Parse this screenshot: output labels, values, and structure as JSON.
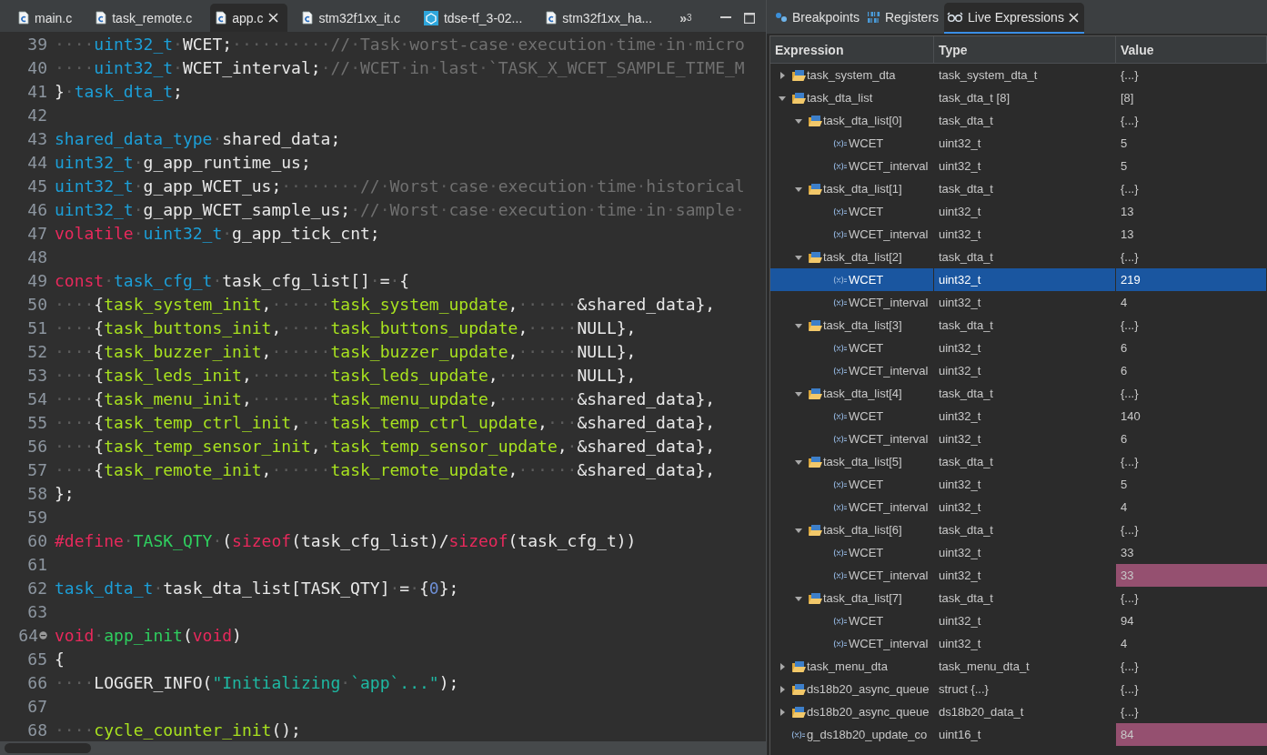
{
  "editor_tabs": [
    {
      "label": "main.c",
      "kind": "c-file",
      "selected": false
    },
    {
      "label": "task_remote.c",
      "kind": "c-file",
      "selected": false
    },
    {
      "label": "app.c",
      "kind": "c-file",
      "selected": true
    },
    {
      "label": "stm32f1xx_it.c",
      "kind": "c-file",
      "selected": false
    },
    {
      "label": "tdse-tf_3-02...",
      "kind": "mx-file",
      "selected": false
    },
    {
      "label": "stm32f1xx_ha...",
      "kind": "c-file",
      "selected": false
    }
  ],
  "overflow_tabs": {
    "symbol": "»",
    "count": "3"
  },
  "code_lines": [
    {
      "number": "39",
      "tokens": [
        {
          "kind": "plain",
          "text": "····"
        },
        {
          "kind": "type",
          "text": "uint32_t"
        },
        {
          "kind": "plain",
          "text": "·WCET;··········"
        },
        {
          "kind": "comment",
          "text": "//·Task·worst-case·execution·time·in·micro"
        }
      ]
    },
    {
      "number": "40",
      "tokens": [
        {
          "kind": "plain",
          "text": "····"
        },
        {
          "kind": "type",
          "text": "uint32_t"
        },
        {
          "kind": "plain",
          "text": "·WCET_interval;·"
        },
        {
          "kind": "comment",
          "text": "//·WCET·in·last·`TASK_X_WCET_SAMPLE_TIME_M"
        }
      ]
    },
    {
      "number": "41",
      "tokens": [
        {
          "kind": "plain",
          "text": "}·"
        },
        {
          "kind": "type",
          "text": "task_dta_t"
        },
        {
          "kind": "plain",
          "text": ";"
        }
      ]
    },
    {
      "number": "42"
    },
    {
      "number": "43",
      "tokens": [
        {
          "kind": "type",
          "text": "shared_data_type"
        },
        {
          "kind": "plain",
          "text": "·shared_data;"
        }
      ]
    },
    {
      "number": "44",
      "tokens": [
        {
          "kind": "type",
          "text": "uint32_t"
        },
        {
          "kind": "plain",
          "text": "·g_app_runtime_us;"
        }
      ]
    },
    {
      "number": "45",
      "tokens": [
        {
          "kind": "type",
          "text": "uint32_t"
        },
        {
          "kind": "plain",
          "text": "·g_app_WCET_us;········"
        },
        {
          "kind": "comment",
          "text": "//·Worst·case·execution·time·historical"
        }
      ]
    },
    {
      "number": "46",
      "tokens": [
        {
          "kind": "type",
          "text": "uint32_t"
        },
        {
          "kind": "plain",
          "text": "·g_app_WCET_sample_us;·"
        },
        {
          "kind": "comment",
          "text": "//·Worst·case·execution·time·in·sample·"
        }
      ]
    },
    {
      "number": "47",
      "tokens": [
        {
          "kind": "keyword",
          "text": "volatile"
        },
        {
          "kind": "plain",
          "text": "·"
        },
        {
          "kind": "type",
          "text": "uint32_t"
        },
        {
          "kind": "plain",
          "text": "·g_app_tick_cnt;"
        }
      ]
    },
    {
      "number": "48"
    },
    {
      "number": "49",
      "tokens": [
        {
          "kind": "keyword",
          "text": "const"
        },
        {
          "kind": "plain",
          "text": "·"
        },
        {
          "kind": "type",
          "text": "task_cfg_t"
        },
        {
          "kind": "plain",
          "text": "·task_cfg_list[]·=·{"
        }
      ]
    },
    {
      "number": "50",
      "tokens": [
        {
          "kind": "plain",
          "text": "····{"
        },
        {
          "kind": "function",
          "text": "task_system_init"
        },
        {
          "kind": "plain",
          "text": ",······"
        },
        {
          "kind": "function",
          "text": "task_system_update"
        },
        {
          "kind": "plain",
          "text": ",······&shared_data},"
        }
      ]
    },
    {
      "number": "51",
      "tokens": [
        {
          "kind": "plain",
          "text": "····{"
        },
        {
          "kind": "function",
          "text": "task_buttons_init"
        },
        {
          "kind": "plain",
          "text": ",·····"
        },
        {
          "kind": "function",
          "text": "task_buttons_update"
        },
        {
          "kind": "plain",
          "text": ",·····NULL},"
        }
      ]
    },
    {
      "number": "52",
      "tokens": [
        {
          "kind": "plain",
          "text": "····{"
        },
        {
          "kind": "function",
          "text": "task_buzzer_init"
        },
        {
          "kind": "plain",
          "text": ",······"
        },
        {
          "kind": "function",
          "text": "task_buzzer_update"
        },
        {
          "kind": "plain",
          "text": ",······NULL},"
        }
      ]
    },
    {
      "number": "53",
      "tokens": [
        {
          "kind": "plain",
          "text": "····{"
        },
        {
          "kind": "function",
          "text": "task_leds_init"
        },
        {
          "kind": "plain",
          "text": ",········"
        },
        {
          "kind": "function",
          "text": "task_leds_update"
        },
        {
          "kind": "plain",
          "text": ",········NULL},"
        }
      ]
    },
    {
      "number": "54",
      "tokens": [
        {
          "kind": "plain",
          "text": "····{"
        },
        {
          "kind": "function",
          "text": "task_menu_init"
        },
        {
          "kind": "plain",
          "text": ",········"
        },
        {
          "kind": "function",
          "text": "task_menu_update"
        },
        {
          "kind": "plain",
          "text": ",········&shared_data},"
        }
      ]
    },
    {
      "number": "55",
      "tokens": [
        {
          "kind": "plain",
          "text": "····{"
        },
        {
          "kind": "function",
          "text": "task_temp_ctrl_init"
        },
        {
          "kind": "plain",
          "text": ",···"
        },
        {
          "kind": "function",
          "text": "task_temp_ctrl_update"
        },
        {
          "kind": "plain",
          "text": ",···&shared_data},"
        }
      ]
    },
    {
      "number": "56",
      "tokens": [
        {
          "kind": "plain",
          "text": "····{"
        },
        {
          "kind": "function",
          "text": "task_temp_sensor_init"
        },
        {
          "kind": "plain",
          "text": ",·"
        },
        {
          "kind": "function",
          "text": "task_temp_sensor_update"
        },
        {
          "kind": "plain",
          "text": ",·&shared_data},"
        }
      ]
    },
    {
      "number": "57",
      "tokens": [
        {
          "kind": "plain",
          "text": "····{"
        },
        {
          "kind": "function",
          "text": "task_remote_init"
        },
        {
          "kind": "plain",
          "text": ",······"
        },
        {
          "kind": "function",
          "text": "task_remote_update"
        },
        {
          "kind": "plain",
          "text": ",······&shared_data},"
        }
      ]
    },
    {
      "number": "58",
      "tokens": [
        {
          "kind": "plain",
          "text": "};"
        }
      ]
    },
    {
      "number": "59"
    },
    {
      "number": "60",
      "tokens": [
        {
          "kind": "keyword",
          "text": "#define"
        },
        {
          "kind": "plain",
          "text": "·"
        },
        {
          "kind": "definition",
          "text": "TASK_QTY"
        },
        {
          "kind": "plain",
          "text": "·("
        },
        {
          "kind": "keyword",
          "text": "sizeof"
        },
        {
          "kind": "plain",
          "text": "(task_cfg_list)/"
        },
        {
          "kind": "keyword",
          "text": "sizeof"
        },
        {
          "kind": "plain",
          "text": "(task_cfg_t))"
        }
      ]
    },
    {
      "number": "61"
    },
    {
      "number": "62",
      "tokens": [
        {
          "kind": "type",
          "text": "task_dta_t"
        },
        {
          "kind": "plain",
          "text": "·task_dta_list[TASK_QTY]·=·{"
        },
        {
          "kind": "number",
          "text": "0"
        },
        {
          "kind": "plain",
          "text": "};"
        }
      ]
    },
    {
      "number": "63"
    },
    {
      "number": "64",
      "fold": true,
      "tokens": [
        {
          "kind": "keyword",
          "text": "void"
        },
        {
          "kind": "plain",
          "text": "·"
        },
        {
          "kind": "definition",
          "text": "app_init"
        },
        {
          "kind": "plain",
          "text": "("
        },
        {
          "kind": "keyword",
          "text": "void"
        },
        {
          "kind": "plain",
          "text": ")"
        }
      ]
    },
    {
      "number": "65",
      "tokens": [
        {
          "kind": "plain",
          "text": "{"
        }
      ]
    },
    {
      "number": "66",
      "tokens": [
        {
          "kind": "plain",
          "text": "····LOGGER_INFO("
        },
        {
          "kind": "string",
          "text": "\"Initializing·`app`...\""
        },
        {
          "kind": "plain",
          "text": ");"
        }
      ]
    },
    {
      "number": "67"
    },
    {
      "number": "68",
      "tokens": [
        {
          "kind": "plain",
          "text": "····"
        },
        {
          "kind": "function",
          "text": "cycle_counter_init"
        },
        {
          "kind": "plain",
          "text": "();"
        }
      ]
    }
  ],
  "view_tabs": [
    {
      "label": "Breakpoints",
      "kind": "breakpoints",
      "selected": false
    },
    {
      "label": "Registers",
      "kind": "registers",
      "selected": false
    },
    {
      "label": "Live Expressions",
      "kind": "expressions",
      "selected": true
    }
  ],
  "table": {
    "columns": [
      "Expression",
      "Type",
      "Value"
    ],
    "rows": [
      {
        "name": "task_system_dta",
        "type": "task_system_dta_t",
        "value": "{...}",
        "kind": "struct",
        "expanded": false,
        "selected": false,
        "changed": false
      },
      {
        "name": "task_dta_list",
        "type": "task_dta_t [8]",
        "value": "[8]",
        "kind": "struct",
        "expanded": true,
        "selected": false,
        "changed": false,
        "children": [
          {
            "name": "task_dta_list[0]",
            "type": "task_dta_t",
            "value": "{...}",
            "kind": "struct",
            "expanded": true,
            "selected": false,
            "changed": false,
            "children": [
              {
                "name": "WCET",
                "type": "uint32_t",
                "value": "5",
                "kind": "variable",
                "selected": false,
                "changed": false
              },
              {
                "name": "WCET_interval",
                "type": "uint32_t",
                "value": "5",
                "kind": "variable",
                "selected": false,
                "changed": false
              }
            ]
          },
          {
            "name": "task_dta_list[1]",
            "type": "task_dta_t",
            "value": "{...}",
            "kind": "struct",
            "expanded": true,
            "selected": false,
            "changed": false,
            "children": [
              {
                "name": "WCET",
                "type": "uint32_t",
                "value": "13",
                "kind": "variable",
                "selected": false,
                "changed": false
              },
              {
                "name": "WCET_interval",
                "type": "uint32_t",
                "value": "13",
                "kind": "variable",
                "selected": false,
                "changed": false
              }
            ]
          },
          {
            "name": "task_dta_list[2]",
            "type": "task_dta_t",
            "value": "{...}",
            "kind": "struct",
            "expanded": true,
            "selected": false,
            "changed": false,
            "children": [
              {
                "name": "WCET",
                "type": "uint32_t",
                "value": "219",
                "kind": "variable",
                "selected": true,
                "changed": false
              },
              {
                "name": "WCET_interval",
                "type": "uint32_t",
                "value": "4",
                "kind": "variable",
                "selected": false,
                "changed": false
              }
            ]
          },
          {
            "name": "task_dta_list[3]",
            "type": "task_dta_t",
            "value": "{...}",
            "kind": "struct",
            "expanded": true,
            "selected": false,
            "changed": false,
            "children": [
              {
                "name": "WCET",
                "type": "uint32_t",
                "value": "6",
                "kind": "variable",
                "selected": false,
                "changed": false
              },
              {
                "name": "WCET_interval",
                "type": "uint32_t",
                "value": "6",
                "kind": "variable",
                "selected": false,
                "changed": false
              }
            ]
          },
          {
            "name": "task_dta_list[4]",
            "type": "task_dta_t",
            "value": "{...}",
            "kind": "struct",
            "expanded": true,
            "selected": false,
            "changed": false,
            "children": [
              {
                "name": "WCET",
                "type": "uint32_t",
                "value": "140",
                "kind": "variable",
                "selected": false,
                "changed": false
              },
              {
                "name": "WCET_interval",
                "type": "uint32_t",
                "value": "6",
                "kind": "variable",
                "selected": false,
                "changed": false
              }
            ]
          },
          {
            "name": "task_dta_list[5]",
            "type": "task_dta_t",
            "value": "{...}",
            "kind": "struct",
            "expanded": true,
            "selected": false,
            "changed": false,
            "children": [
              {
                "name": "WCET",
                "type": "uint32_t",
                "value": "5",
                "kind": "variable",
                "selected": false,
                "changed": false
              },
              {
                "name": "WCET_interval",
                "type": "uint32_t",
                "value": "4",
                "kind": "variable",
                "selected": false,
                "changed": false
              }
            ]
          },
          {
            "name": "task_dta_list[6]",
            "type": "task_dta_t",
            "value": "{...}",
            "kind": "struct",
            "expanded": true,
            "selected": false,
            "changed": false,
            "children": [
              {
                "name": "WCET",
                "type": "uint32_t",
                "value": "33",
                "kind": "variable",
                "selected": false,
                "changed": false
              },
              {
                "name": "WCET_interval",
                "type": "uint32_t",
                "value": "33",
                "kind": "variable",
                "selected": false,
                "changed": true
              }
            ]
          },
          {
            "name": "task_dta_list[7]",
            "type": "task_dta_t",
            "value": "{...}",
            "kind": "struct",
            "expanded": true,
            "selected": false,
            "changed": false,
            "children": [
              {
                "name": "WCET",
                "type": "uint32_t",
                "value": "94",
                "kind": "variable",
                "selected": false,
                "changed": false
              },
              {
                "name": "WCET_interval",
                "type": "uint32_t",
                "value": "4",
                "kind": "variable",
                "selected": false,
                "changed": false
              }
            ]
          }
        ]
      },
      {
        "name": "task_menu_dta",
        "type": "task_menu_dta_t",
        "value": "{...}",
        "kind": "struct",
        "expanded": false,
        "selected": false,
        "changed": false
      },
      {
        "name": "ds18b20_async_queue",
        "type": "struct {...}",
        "value": "{...}",
        "kind": "struct",
        "expanded": false,
        "selected": false,
        "changed": false
      },
      {
        "name": "ds18b20_async_queue",
        "type": "ds18b20_data_t",
        "value": "{...}",
        "kind": "struct",
        "expanded": false,
        "selected": false,
        "changed": false
      },
      {
        "name": "g_ds18b20_update_co",
        "type": "uint16_t",
        "value": "84",
        "kind": "variable",
        "selected": false,
        "changed": true
      }
    ]
  }
}
